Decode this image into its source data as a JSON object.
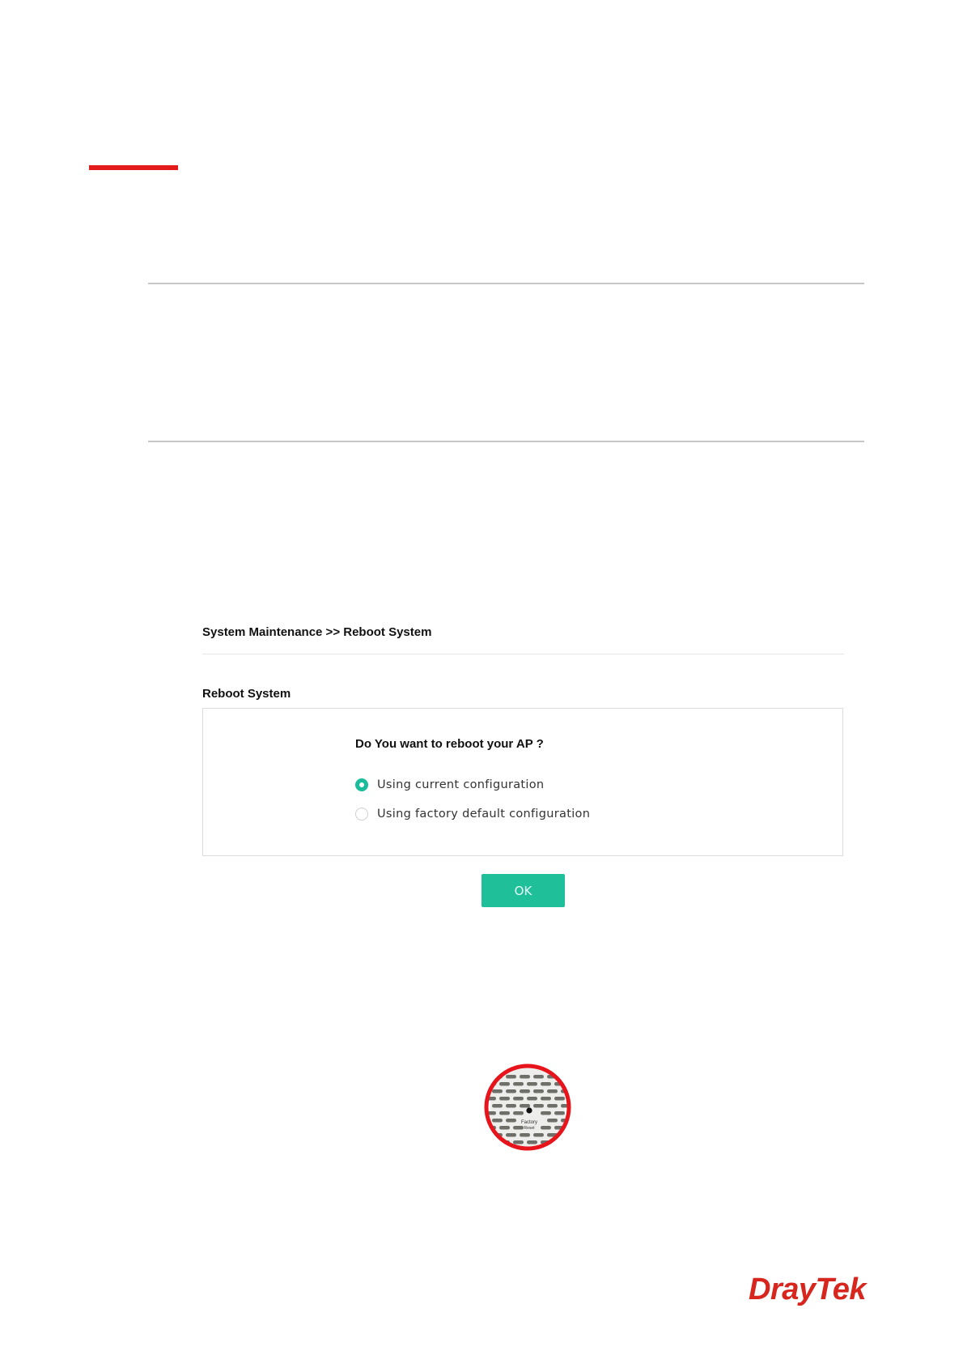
{
  "breadcrumb": "System Maintenance >> Reboot System",
  "section_title": "Reboot System",
  "question": "Do You want to reboot your AP ?",
  "options": [
    {
      "label": "Using current configuration",
      "selected": true
    },
    {
      "label": "Using factory default configuration",
      "selected": false
    }
  ],
  "ok_label": "OK",
  "device_label": [
    "Factory",
    "Reset"
  ],
  "logo": "DrayTek",
  "colors": {
    "accent_red": "#e31b1b",
    "teal": "#1abc9c",
    "logo_red": "#d7261e"
  }
}
